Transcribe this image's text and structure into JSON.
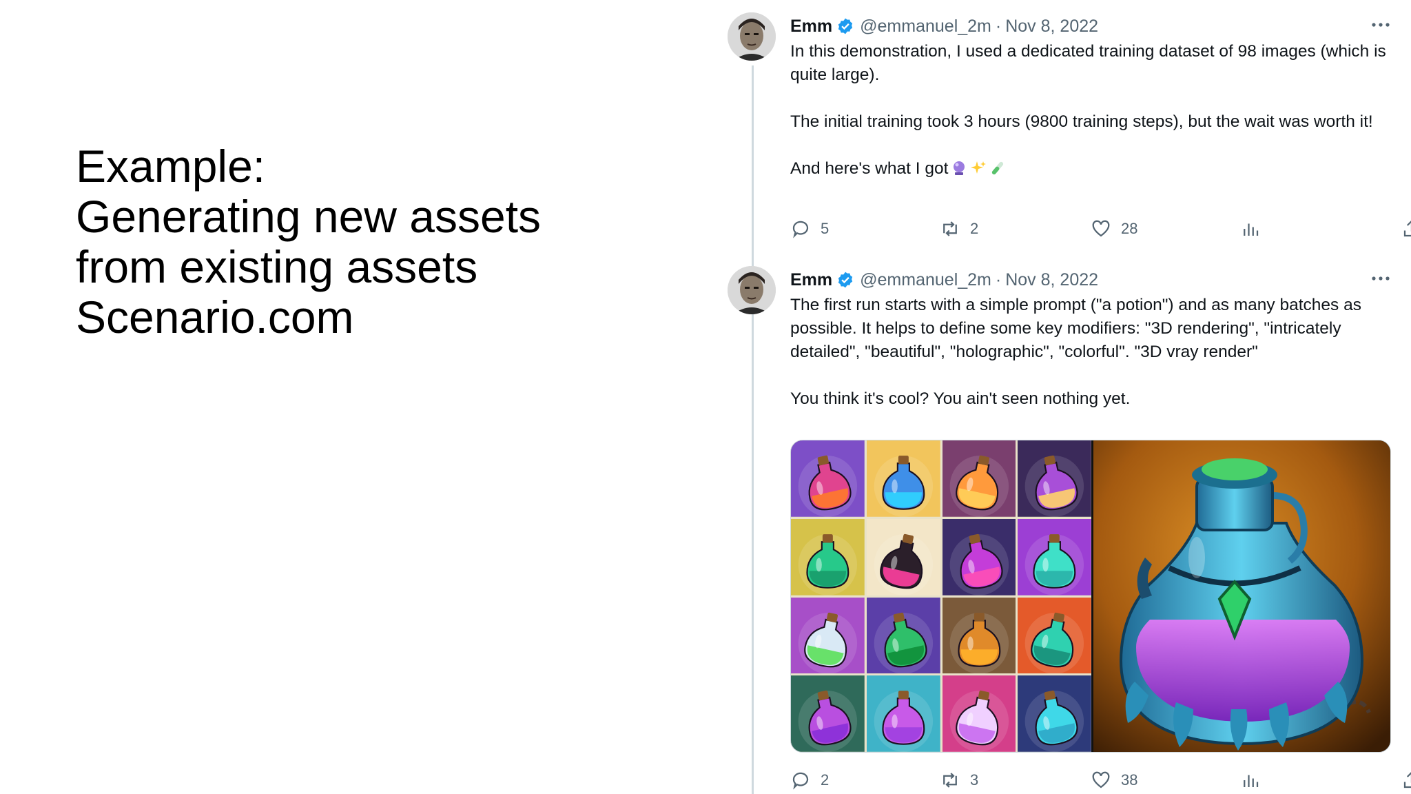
{
  "slide": {
    "title_lines": [
      "Example:",
      "Generating new assets",
      "from existing assets",
      "Scenario.com"
    ]
  },
  "colors": {
    "verified": "#1d9bf0",
    "muted": "#536471",
    "divider": "#cfd9de",
    "text": "#0f1419"
  },
  "tweets": [
    {
      "name": "Emm",
      "handle": "@emmanuel_2m",
      "date": "Nov 8, 2022",
      "separator": "·",
      "paragraphs": [
        "In this demonstration, I used a dedicated training dataset of 98 images (which is quite large).",
        "The initial training took 3 hours (9800 training steps), but the wait was worth it!",
        "And here's what I got"
      ],
      "emojis": [
        "crystal-ball-emoji",
        "sparkles-emoji",
        "test-tube-emoji"
      ],
      "stats": {
        "replies": "5",
        "retweets": "2",
        "likes": "28"
      }
    },
    {
      "name": "Emm",
      "handle": "@emmanuel_2m",
      "date": "Nov 8, 2022",
      "separator": "·",
      "paragraphs": [
        "The first run starts with a simple prompt (\"a potion\") and as many batches as possible. It helps to define some key modifiers: \"3D rendering\", \"intricately detailed\", \"beautiful\", \"holographic\", \"colorful\". \"3D vray render\"",
        "You think it's cool? You ain't seen nothing yet."
      ],
      "stats": {
        "replies": "2",
        "retweets": "3",
        "likes": "38"
      },
      "media": {
        "grid_tiles": [
          {
            "bg": "#7d4fc7",
            "glass": "#e0448f",
            "liquid": "#ff7a2a"
          },
          {
            "bg": "#f2c55c",
            "glass": "#3f8fe8",
            "liquid": "#2fd4ff"
          },
          {
            "bg": "#7a3f6e",
            "glass": "#ff9a3c",
            "liquid": "#ffd05a"
          },
          {
            "bg": "#3b2a5a",
            "glass": "#a84fd8",
            "liquid": "#ffd36a"
          },
          {
            "bg": "#d6c24a",
            "glass": "#27c98a",
            "liquid": "#1a9c6a"
          },
          {
            "bg": "#f3e6c8",
            "glass": "#2b1f2a",
            "liquid": "#ff3fa0"
          },
          {
            "bg": "#3a2d6a",
            "glass": "#c43dd9",
            "liquid": "#ff4fb5"
          },
          {
            "bg": "#9c3fd4",
            "glass": "#3fe0c8",
            "liquid": "#2ab3a8"
          },
          {
            "bg": "#a74fc8",
            "glass": "#d9e9f5",
            "liquid": "#5be05b"
          },
          {
            "bg": "#5b3fa8",
            "glass": "#2fbf6a",
            "liquid": "#0f8f3a"
          },
          {
            "bg": "#7b5a3a",
            "glass": "#e08a2a",
            "liquid": "#ffb02a"
          },
          {
            "bg": "#e45a2a",
            "glass": "#2fd1b0",
            "liquid": "#1a8f7a"
          },
          {
            "bg": "#2f6a5a",
            "glass": "#b94fe0",
            "liquid": "#8a2fd8"
          },
          {
            "bg": "#3fb3c8",
            "glass": "#c85ae8",
            "liquid": "#9f3fe0"
          },
          {
            "bg": "#d43f8a",
            "glass": "#f0d0ff",
            "liquid": "#c86af0"
          },
          {
            "bg": "#2d3a7a",
            "glass": "#3fd8e8",
            "liquid": "#2fa8c8"
          }
        ],
        "hero": {
          "bg_light": "#c97a1a",
          "bg_dark": "#3a1d05",
          "glass": "#3aa9d6",
          "liquid": "#b24ae0",
          "cork": "#49d16a"
        }
      }
    }
  ]
}
